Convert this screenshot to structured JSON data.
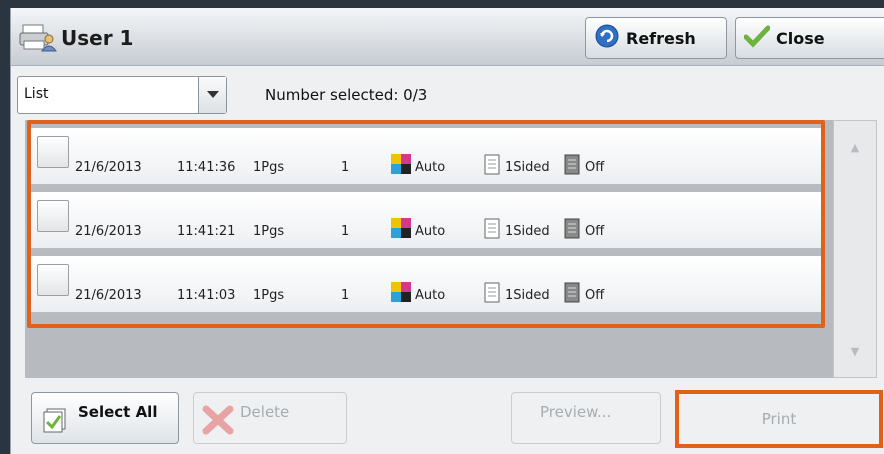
{
  "title": "User 1",
  "buttons": {
    "refresh": "Refresh",
    "close": "Close",
    "select_all": "Select All",
    "delete": "Delete",
    "preview": "Preview...",
    "print": "Print"
  },
  "view_select": {
    "value": "List"
  },
  "number_selected": "Number selected: 0/3",
  "jobs": [
    {
      "date": "21/6/2013",
      "time": "11:41:36",
      "pages": "1Pgs",
      "copies": "1",
      "color": "Auto",
      "sides": "1Sided",
      "staple": "Off"
    },
    {
      "date": "21/6/2013",
      "time": "11:41:21",
      "pages": "1Pgs",
      "copies": "1",
      "color": "Auto",
      "sides": "1Sided",
      "staple": "Off"
    },
    {
      "date": "21/6/2013",
      "time": "11:41:03",
      "pages": "1Pgs",
      "copies": "1",
      "color": "Auto",
      "sides": "1Sided",
      "staple": "Off"
    }
  ],
  "icons": {
    "title": "printer-user-icon",
    "refresh": "refresh-icon",
    "close": "checkmark-icon",
    "select_all": "select-all-icon",
    "delete": "delete-x-icon"
  },
  "colors": {
    "highlight": "#e0621a",
    "titlebar": "#c7ccd2",
    "disabled_text": "#a7acb1"
  }
}
